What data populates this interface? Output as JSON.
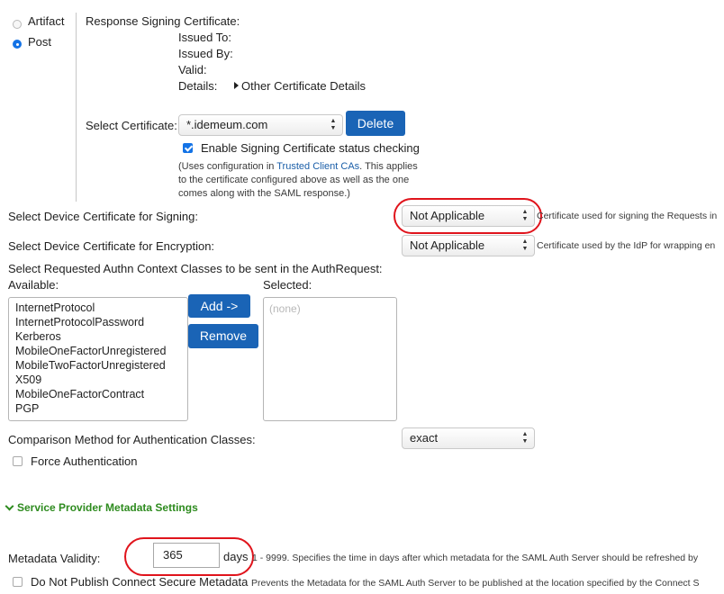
{
  "binding": {
    "artifact_label": "Artifact",
    "post_label": "Post",
    "selected": "Post"
  },
  "signing_cert": {
    "heading": "Response Signing Certificate:",
    "issued_to_label": "Issued To:",
    "issued_by_label": "Issued By:",
    "valid_label": "Valid:",
    "details_label": "Details:",
    "details_link": "Other Certificate Details",
    "select_label": "Select Certificate:",
    "select_value": "*.idemeum.com",
    "delete_button": "Delete",
    "enable_status_label": "Enable Signing Certificate status checking",
    "enable_status_checked": true,
    "note_prefix": "(Uses configuration in ",
    "note_link": "Trusted Client CAs",
    "note_line1_rest": ". This applies",
    "note_line2": "to the certificate configured above as well as the one",
    "note_line3": "comes along with the SAML response.)"
  },
  "device_signing": {
    "label": "Select Device Certificate for Signing:",
    "value": "Not Applicable",
    "help": "Certificate used for signing the Requests in"
  },
  "device_encryption": {
    "label": "Select Device Certificate for Encryption:",
    "value": "Not Applicable",
    "help": "Certificate used by the IdP for wrapping en"
  },
  "authn": {
    "heading": "Select Requested Authn Context Classes to be sent in the AuthRequest:",
    "available_label": "Available:",
    "selected_label": "Selected:",
    "available_items": [
      "InternetProtocol",
      "InternetProtocolPassword",
      "Kerberos",
      "MobileOneFactorUnregistered",
      "MobileTwoFactorUnregistered",
      "X509",
      "MobileOneFactorContract",
      "PGP"
    ],
    "selected_placeholder": "(none)",
    "add_button": "Add ->",
    "remove_button": "Remove",
    "comparison_label": "Comparison Method for Authentication Classes:",
    "comparison_value": "exact",
    "force_auth_label": "Force Authentication",
    "force_auth_checked": false
  },
  "metadata": {
    "section_title": "Service Provider Metadata Settings",
    "validity_label": "Metadata Validity:",
    "validity_value": "365",
    "validity_unit": "days",
    "validity_help": "1 - 9999. Specifies the time in days after which metadata for the SAML Auth Server should be refreshed by",
    "no_publish_label": "Do Not Publish Connect Secure Metadata",
    "no_publish_checked": false,
    "no_publish_help": "Prevents the Metadata for the SAML Auth Server to be published at the location specified by the Connect S"
  },
  "colors": {
    "accent": "#1a64b6",
    "section_green": "#2e8b1f",
    "highlight_red": "#e0141c",
    "link": "#1a5ea8"
  }
}
